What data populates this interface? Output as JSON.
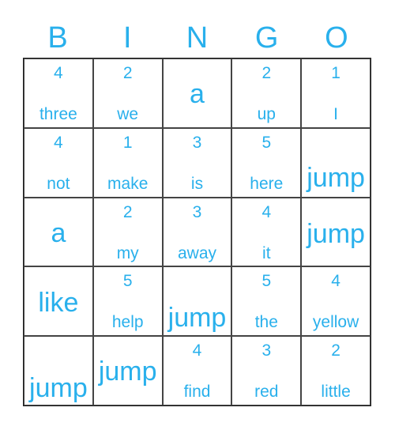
{
  "header": [
    "B",
    "I",
    "N",
    "G",
    "O"
  ],
  "accent_color": "#29b0ec",
  "cells": [
    [
      {
        "num": "4",
        "word": "three"
      },
      {
        "num": "2",
        "word": "we"
      },
      {
        "big": "a"
      },
      {
        "num": "2",
        "word": "up"
      },
      {
        "num": "1",
        "word": "I"
      }
    ],
    [
      {
        "num": "4",
        "word": "not"
      },
      {
        "num": "1",
        "word": "make"
      },
      {
        "num": "3",
        "word": "is"
      },
      {
        "num": "5",
        "word": "here"
      },
      {
        "big": "jump"
      }
    ],
    [
      {
        "big": "a"
      },
      {
        "num": "2",
        "word": "my"
      },
      {
        "num": "3",
        "word": "away"
      },
      {
        "num": "4",
        "word": "it"
      },
      {
        "big": "jump"
      }
    ],
    [
      {
        "big": "like"
      },
      {
        "num": "5",
        "word": "help"
      },
      {
        "big": "jump"
      },
      {
        "num": "5",
        "word": "the"
      },
      {
        "num": "4",
        "word": "yellow"
      }
    ],
    [
      {
        "big": "jump"
      },
      {
        "big": "jump"
      },
      {
        "num": "4",
        "word": "find"
      },
      {
        "num": "3",
        "word": "red"
      },
      {
        "num": "2",
        "word": "little"
      }
    ]
  ]
}
